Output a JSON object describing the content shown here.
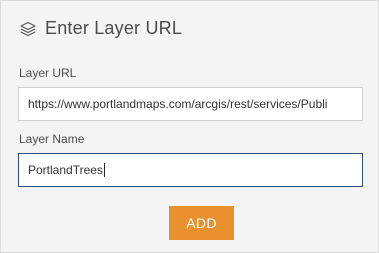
{
  "header": {
    "icon": "layers-icon",
    "title": "Enter Layer URL"
  },
  "form": {
    "url_label": "Layer URL",
    "url_value": "https://www.portlandmaps.com/arcgis/rest/services/Publi",
    "name_label": "Layer Name",
    "name_value": "PortlandTrees"
  },
  "actions": {
    "add_label": "ADD"
  },
  "colors": {
    "accent": "#e8912e",
    "focus_border": "#2c4e7d",
    "panel_bg": "#f4f4f4",
    "text": "#4c4c4c"
  }
}
